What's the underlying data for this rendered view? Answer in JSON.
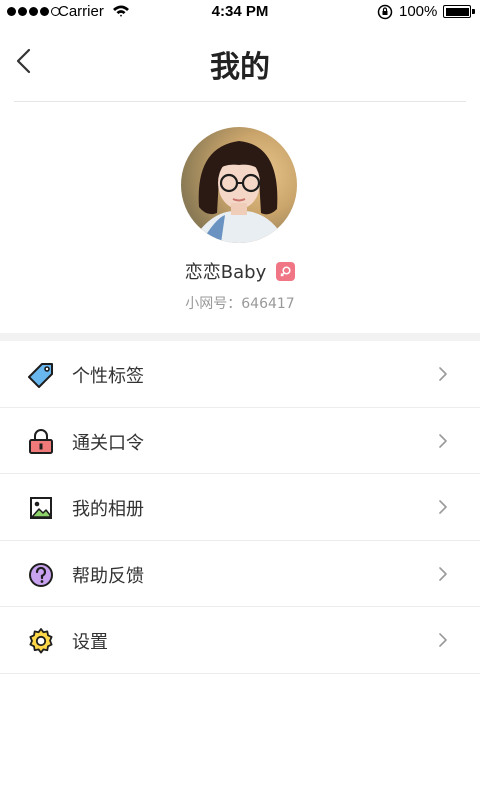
{
  "status_bar": {
    "carrier": "Carrier",
    "time": "4:34 PM",
    "battery": "100%"
  },
  "nav": {
    "title": "我的",
    "back_icon": "chevron-left-icon"
  },
  "profile": {
    "nickname": "恋恋Baby",
    "account_id": "小网号：646417",
    "gender_badge_color": "#f07685"
  },
  "menu": {
    "items": [
      {
        "label": "个性标签",
        "icon": "tag-icon"
      },
      {
        "label": "通关口令",
        "icon": "lock-icon"
      },
      {
        "label": "我的相册",
        "icon": "photo-album-icon"
      },
      {
        "label": "帮助反馈",
        "icon": "help-icon"
      },
      {
        "label": "设置",
        "icon": "settings-gear-icon"
      }
    ]
  },
  "colors": {
    "accent_pink": "#f07685",
    "tag_blue": "#69b7ef",
    "lock_red": "#f07a7a",
    "help_purple": "#c9a3ef",
    "gear_yellow": "#ffd84a",
    "photo_green": "#8ed36a"
  }
}
